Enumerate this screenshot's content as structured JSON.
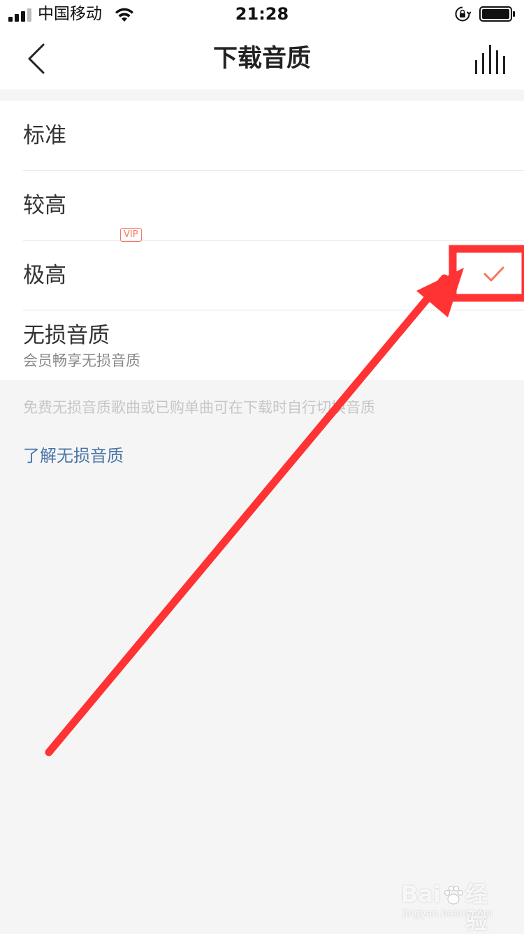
{
  "status_bar": {
    "carrier": "中国移动",
    "time": "21:28",
    "icons": [
      "signal-icon",
      "wifi-icon",
      "rotation-lock-icon",
      "battery-icon"
    ]
  },
  "nav": {
    "title": "下载音质",
    "back_icon": "back-chevron-icon",
    "right_icon": "equalizer-icon"
  },
  "quality_options": [
    {
      "label": "标准",
      "selected": false
    },
    {
      "label": "较高",
      "selected": false
    },
    {
      "label": "极高",
      "selected": true
    },
    {
      "label": "无损音质",
      "badge": "VIP",
      "subtitle": "会员畅享无损音质",
      "selected": false
    }
  ],
  "footer": {
    "note": "免费无损音质歌曲或已购单曲可在下载时自行切换音质",
    "link": "了解无损音质"
  },
  "colors": {
    "accent": "#f3785e",
    "link": "#4a75a8",
    "annotation": "#ff3333"
  },
  "watermark": {
    "brand": "Bai",
    "brand2": "经验",
    "url": "jingyan.baidu.com"
  }
}
